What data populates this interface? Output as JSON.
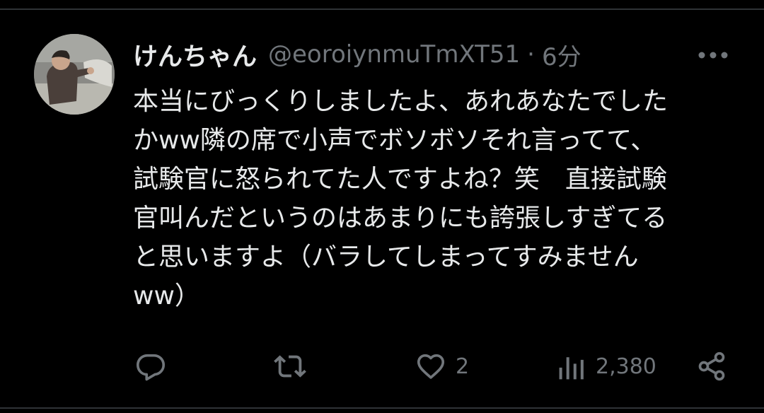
{
  "tweet": {
    "display_name": "けんちゃん",
    "handle": "@eoroiynmuTmXT51",
    "separator": "·",
    "timestamp": "6分",
    "text": "本当にびっくりしましたよ、あれあなたでした\nかww隣の席で小声でボソボソそれ言ってて、\n試験官に怒られてた人ですよね？笑　直接試験\n官叫んだというのはあまりにも誇張しすぎてる\nと思いますよ（バラしてしまってすみません\nww）"
  },
  "actions": {
    "reply": {
      "icon": "reply-icon"
    },
    "retweet": {
      "icon": "retweet-icon"
    },
    "like": {
      "icon": "heart-icon",
      "count": "2"
    },
    "views": {
      "icon": "analytics-icon",
      "count": "2,380"
    },
    "share": {
      "icon": "share-icon"
    }
  },
  "colors": {
    "background": "#000000",
    "text": "#e7e9ea",
    "secondary": "#71767b",
    "divider": "#2f3336"
  }
}
